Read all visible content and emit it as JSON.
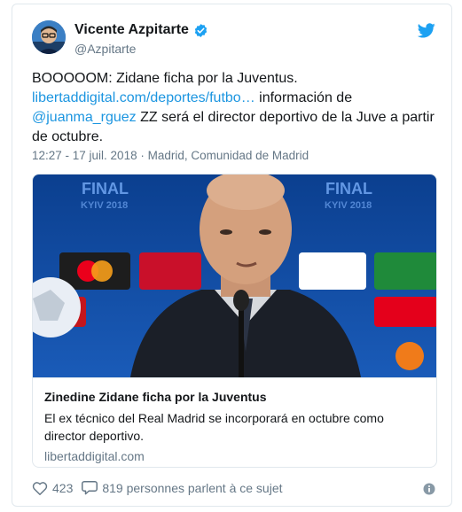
{
  "author": {
    "name": "Vicente Azpitarte",
    "handle": "@Azpitarte"
  },
  "tweet": {
    "line1": "BOOOOOM: Zidane ficha por la Juventus.",
    "link_url": "libertaddigital.com/deportes/futbo…",
    "text_mid": " información de ",
    "mention": "@juanma_rguez",
    "text_end": " ZZ será el director deportivo de la Juve a partir de octubre.",
    "meta": "12:27 - 17 juil. 2018 · Madrid, Comunidad de Madrid"
  },
  "card": {
    "title": "Zinedine Zidane ficha por la Juventus",
    "description": "El ex técnico del Real Madrid se incorporará en octubre como director deportivo.",
    "domain": "libertaddigital.com",
    "backdrop_text": "FINAL KYIV 2018"
  },
  "footer": {
    "likes": "423",
    "talking": "819 personnes parlent à ce sujet"
  },
  "colors": {
    "link": "#1b95e0",
    "muted": "#657786",
    "verified": "#1da1f2"
  }
}
